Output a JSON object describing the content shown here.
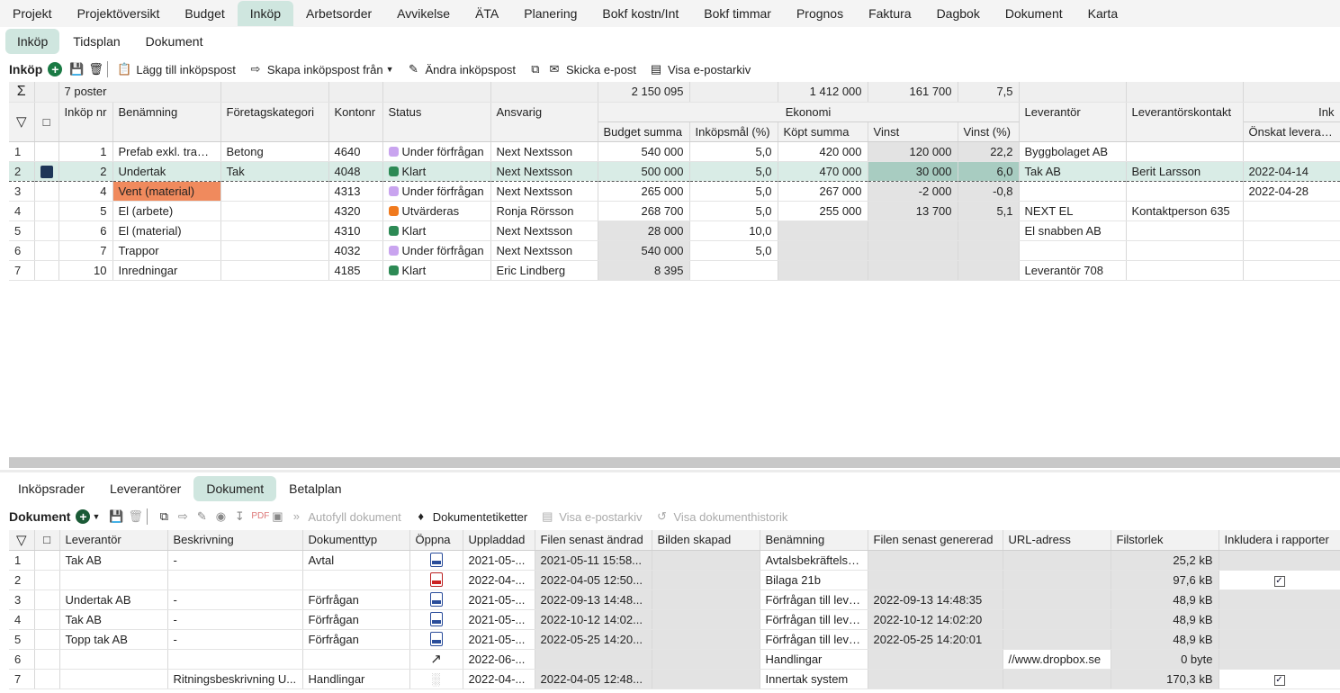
{
  "top_tabs": [
    "Projekt",
    "Projektöversikt",
    "Budget",
    "Inköp",
    "Arbetsorder",
    "Avvikelse",
    "ÄTA",
    "Planering",
    "Bokf kostn/Int",
    "Bokf timmar",
    "Prognos",
    "Faktura",
    "Dagbok",
    "Dokument",
    "Karta"
  ],
  "sub_tabs": [
    "Inköp",
    "Tidsplan",
    "Dokument"
  ],
  "toolbar1": {
    "title": "Inköp",
    "add": "Lägg till inköpspost",
    "create": "Skapa inköpspost från",
    "edit": "Ändra inköpspost",
    "email": "Skicka e-post",
    "archive": "Visa e-postarkiv"
  },
  "grid1": {
    "sums": {
      "count": "7 poster",
      "budget": "2 150 095",
      "kopt": "1 412 000",
      "vinst": "161 700",
      "vinst_pct": "7,5"
    },
    "headers": {
      "inkopnr": "Inköp nr",
      "benamning": "Benämning",
      "foretagskategori": "Företagskategori",
      "kontonr": "Kontonr",
      "status": "Status",
      "ansvarig": "Ansvarig",
      "ekonomi": "Ekonomi",
      "leverantor": "Leverantör",
      "leverantorskontakt": "Leverantörskontakt",
      "ink": "Ink",
      "budget": "Budget summa",
      "inkopsmal": "Inköpsmål (%)",
      "kopt": "Köpt summa",
      "vinst": "Vinst",
      "vinst_pct": "Vinst (%)",
      "onskat": "Önskat leveransda"
    },
    "status_colors": {
      "Under förfrågan": "#c9a4ef",
      "Klart": "#2d8a55",
      "Utvärderas": "#f07a1e"
    },
    "rows": [
      {
        "n": "1",
        "nr": "1",
        "ben": "Prefab exkl. trapp...",
        "kat": "Betong",
        "konto": "4640",
        "status": "Under förfrågan",
        "ansv": "Next Nextsson",
        "budget": "540 000",
        "mal": "5,0",
        "kopt": "420 000",
        "vinst": "120 000",
        "vpct": "22,2",
        "lev": "Byggbolaget AB",
        "kontakt": "",
        "datum": ""
      },
      {
        "n": "2",
        "nr": "2",
        "ben": "Undertak",
        "kat": "Tak",
        "konto": "4048",
        "status": "Klart",
        "ansv": "Next Nextsson",
        "budget": "500 000",
        "mal": "5,0",
        "kopt": "470 000",
        "vinst": "30 000",
        "vpct": "6,0",
        "lev": "Tak AB",
        "kontakt": "Berit Larsson",
        "datum": "2022-04-14"
      },
      {
        "n": "3",
        "nr": "4",
        "ben": "Vent (material)",
        "kat": "",
        "konto": "4313",
        "status": "Under förfrågan",
        "ansv": "Next Nextsson",
        "budget": "265 000",
        "mal": "5,0",
        "kopt": "267 000",
        "vinst": "-2 000",
        "vpct": "-0,8",
        "lev": "",
        "kontakt": "",
        "datum": "2022-04-28"
      },
      {
        "n": "4",
        "nr": "5",
        "ben": "El (arbete)",
        "kat": "",
        "konto": "4320",
        "status": "Utvärderas",
        "ansv": "Ronja Rörsson",
        "budget": "268 700",
        "mal": "5,0",
        "kopt": "255 000",
        "vinst": "13 700",
        "vpct": "5,1",
        "lev": "NEXT EL",
        "kontakt": "Kontaktperson 635",
        "datum": ""
      },
      {
        "n": "5",
        "nr": "6",
        "ben": "El (material)",
        "kat": "",
        "konto": "4310",
        "status": "Klart",
        "ansv": "Next Nextsson",
        "budget": "28 000",
        "mal": "10,0",
        "kopt": "",
        "vinst": "",
        "vpct": "",
        "lev": "El snabben AB",
        "kontakt": "",
        "datum": ""
      },
      {
        "n": "6",
        "nr": "7",
        "ben": "Trappor",
        "kat": "",
        "konto": "4032",
        "status": "Under förfrågan",
        "ansv": "Next Nextsson",
        "budget": "540 000",
        "mal": "5,0",
        "kopt": "",
        "vinst": "",
        "vpct": "",
        "lev": "",
        "kontakt": "",
        "datum": ""
      },
      {
        "n": "7",
        "nr": "10",
        "ben": "Inredningar",
        "kat": "",
        "konto": "4185",
        "status": "Klart",
        "ansv": "Eric Lindberg",
        "budget": "8 395",
        "mal": "",
        "kopt": "",
        "vinst": "",
        "vpct": "",
        "lev": "Leverantör 708",
        "kontakt": "",
        "datum": ""
      }
    ]
  },
  "bottom_tabs": [
    "Inköpsrader",
    "Leverantörer",
    "Dokument",
    "Betalplan"
  ],
  "toolbar2": {
    "title": "Dokument",
    "autofill": "Autofyll dokument",
    "etiketter": "Dokumentetiketter",
    "arkiv": "Visa e-postarkiv",
    "historik": "Visa dokumenthistorik"
  },
  "grid2": {
    "headers": {
      "lev": "Leverantör",
      "besk": "Beskrivning",
      "typ": "Dokumenttyp",
      "oppna": "Öppna",
      "upp": "Uppladdad",
      "andrad": "Filen senast ändrad",
      "bild": "Bilden skapad",
      "ben": "Benämning",
      "gen": "Filen senast genererad",
      "url": "URL-adress",
      "storlek": "Filstorlek",
      "ink": "Inkludera i rapporter"
    },
    "rows": [
      {
        "n": "1",
        "lev": "Tak AB",
        "besk": "-",
        "typ": "Avtal",
        "icon": "doc",
        "upp": "2021-05-...",
        "andrad": "2021-05-11 15:58...",
        "ben": "Avtalsbekräftelse...",
        "gen": "",
        "url": "",
        "storlek": "25,2 kB",
        "ink": false
      },
      {
        "n": "2",
        "lev": "",
        "besk": "",
        "typ": "",
        "icon": "pdf",
        "upp": "2022-04-...",
        "andrad": "2022-04-05 12:50...",
        "ben": "Bilaga 21b",
        "gen": "",
        "url": "",
        "storlek": "97,6 kB",
        "ink": true
      },
      {
        "n": "3",
        "lev": "Undertak AB",
        "besk": "-",
        "typ": "Förfrågan",
        "icon": "doc",
        "upp": "2021-05-...",
        "andrad": "2022-09-13 14:48...",
        "ben": "Förfrågan till leve...",
        "gen": "2022-09-13 14:48:35",
        "url": "",
        "storlek": "48,9 kB",
        "ink": false
      },
      {
        "n": "4",
        "lev": "Tak AB",
        "besk": "-",
        "typ": "Förfrågan",
        "icon": "doc",
        "upp": "2021-05-...",
        "andrad": "2022-10-12 14:02...",
        "ben": "Förfrågan till leve...",
        "gen": "2022-10-12 14:02:20",
        "url": "",
        "storlek": "48,9 kB",
        "ink": false
      },
      {
        "n": "5",
        "lev": "Topp tak AB",
        "besk": "-",
        "typ": "Förfrågan",
        "icon": "doc",
        "upp": "2021-05-...",
        "andrad": "2022-05-25 14:20...",
        "ben": "Förfrågan till leve...",
        "gen": "2022-05-25 14:20:01",
        "url": "",
        "storlek": "48,9 kB",
        "ink": false
      },
      {
        "n": "6",
        "lev": "",
        "besk": "",
        "typ": "",
        "icon": "link",
        "upp": "2022-06-...",
        "andrad": "",
        "ben": "Handlingar",
        "gen": "",
        "url": "//www.dropbox.se",
        "storlek": "0 byte",
        "ink": false
      },
      {
        "n": "7",
        "lev": "",
        "besk": "Ritningsbeskrivning U...",
        "typ": "Handlingar",
        "icon": "img",
        "upp": "2022-04-...",
        "andrad": "2022-04-05 12:48...",
        "ben": "Innertak system",
        "gen": "",
        "url": "",
        "storlek": "170,3 kB",
        "ink": true
      }
    ]
  }
}
